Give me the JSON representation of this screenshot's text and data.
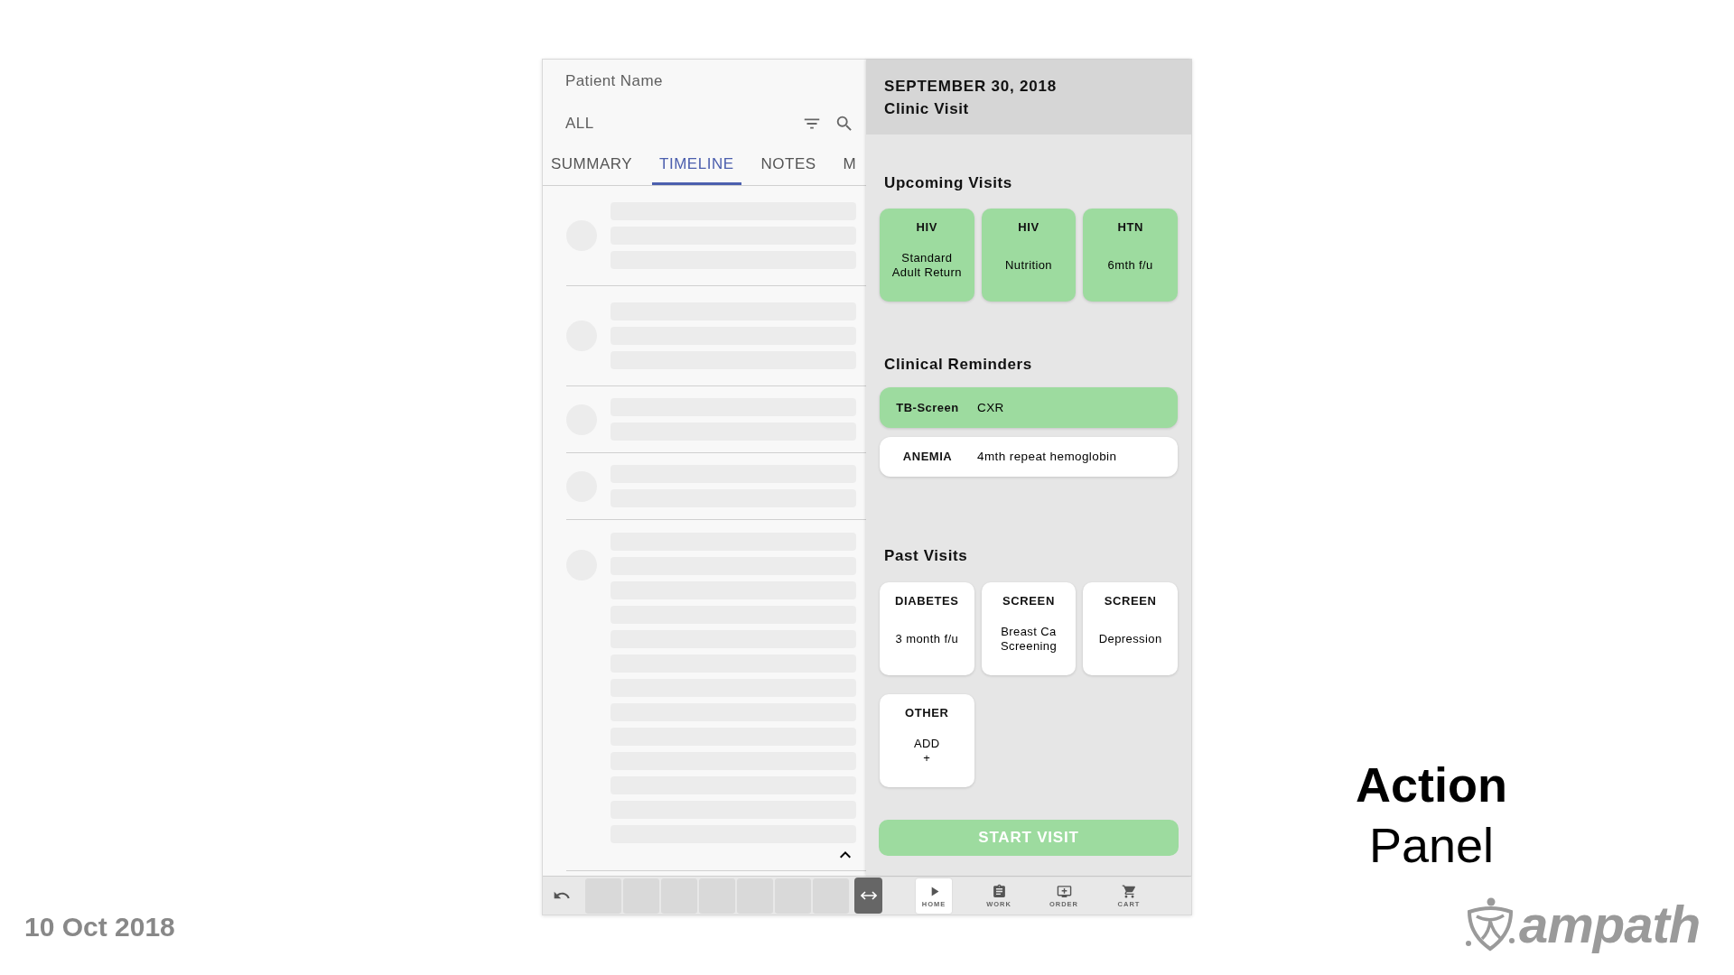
{
  "timeline_panel": {
    "patient_name": "Patient Name",
    "filter": "ALL",
    "tabs": [
      {
        "label": "SUMMARY",
        "selected": false
      },
      {
        "label": "TIMELINE",
        "selected": true
      },
      {
        "label": "NOTES",
        "selected": false
      },
      {
        "label": "M",
        "selected": false
      }
    ]
  },
  "action_panel": {
    "date": "SEPTEMBER 30, 2018",
    "visit_type": "Clinic Visit",
    "upcoming_visits": {
      "heading": "Upcoming Visits",
      "cards": [
        {
          "category": "HIV",
          "description": "Standard\nAdult Return"
        },
        {
          "category": "HIV",
          "description": "Nutrition"
        },
        {
          "category": "HTN",
          "description": "6mth f/u"
        }
      ]
    },
    "clinical_reminders": {
      "heading": "Clinical Reminders",
      "items": [
        {
          "label": "TB-Screen",
          "detail": "CXR",
          "highlighted": true
        },
        {
          "label": "ANEMIA",
          "detail": "4mth repeat hemoglobin",
          "highlighted": false
        }
      ]
    },
    "past_visits": {
      "heading": "Past Visits",
      "cards": [
        {
          "category": "DIABETES",
          "description": "3 month f/u"
        },
        {
          "category": "SCREEN",
          "description": "Breast Ca\nScreening"
        },
        {
          "category": "SCREEN",
          "description": "Depression"
        },
        {
          "category": "OTHER",
          "description": "ADD\n+"
        }
      ]
    },
    "start_button": "START VISIT"
  },
  "bottom_toolbar": {
    "nav": [
      {
        "label": "HOME",
        "selected": true
      },
      {
        "label": "WORK",
        "selected": false
      },
      {
        "label": "ORDER",
        "selected": false
      },
      {
        "label": "CART",
        "selected": false
      }
    ]
  },
  "slide": {
    "date": "10 Oct 2018",
    "title": [
      {
        "text": "Action",
        "bold": true
      },
      {
        "text": "Panel",
        "bold": false
      }
    ],
    "logo_text": "ampath"
  }
}
